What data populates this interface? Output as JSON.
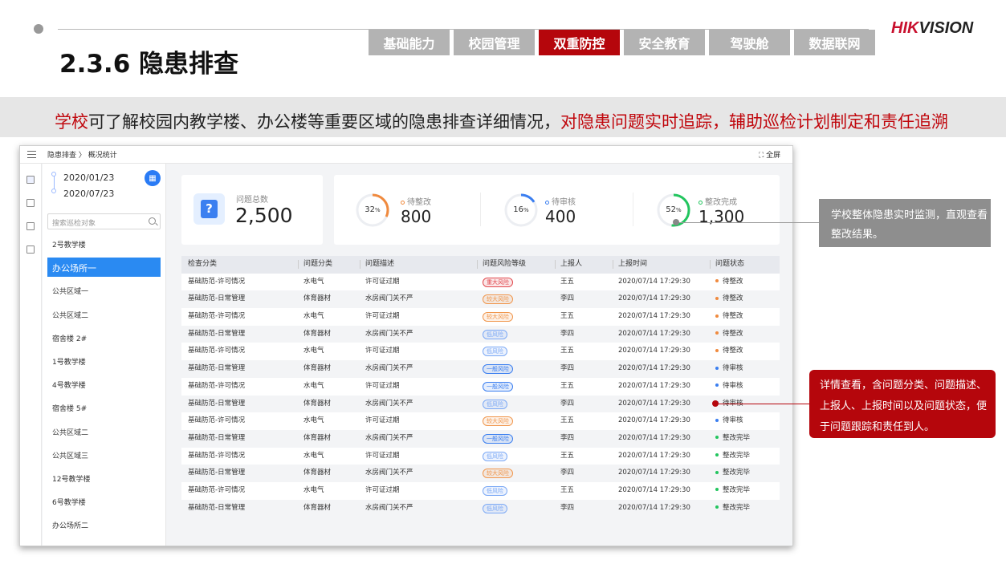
{
  "header": {
    "title": "2.3.6 隐患排查",
    "nav_tabs": [
      {
        "label": "基础能力",
        "active": false
      },
      {
        "label": "校园管理",
        "active": false
      },
      {
        "label": "双重防控",
        "active": true
      },
      {
        "label": "安全教育",
        "active": false
      },
      {
        "label": "驾驶舱",
        "active": false
      },
      {
        "label": "数据联网",
        "active": false
      }
    ],
    "logo_text": "HIKVISION",
    "accent_color": "#b5060c"
  },
  "banner": {
    "part1": "学校",
    "part2": "可了解校园内教学楼、办公楼等重要区域的隐患排查详细情况，",
    "part3": "对隐患问题实时追踪，辅助巡检计划制定和责任追溯"
  },
  "app": {
    "breadcrumb": "隐患排查 〉 概况统计",
    "fullscreen_label": "⛶ 全屏",
    "date_start": "2020/01/23",
    "date_end": "2020/07/23",
    "search_placeholder": "搜索巡检对象",
    "sidebar_items": [
      "2号教学楼",
      "办公场所一",
      "公共区域一",
      "公共区域二",
      "宿舍楼 2#",
      "1号教学楼",
      "4号教学楼",
      "宿舍楼 5#",
      "公共区域二",
      "公共区域三",
      "12号教学楼",
      "6号教学楼",
      "办公场所二"
    ],
    "sidebar_active_index": 1,
    "total": {
      "label": "问题总数",
      "value": "2,500",
      "icon": "question-icon"
    },
    "stats": [
      {
        "label": "待整改",
        "value": "800",
        "percent": 32,
        "color": "#f08a3e"
      },
      {
        "label": "待审核",
        "value": "400",
        "percent": 16,
        "color": "#3a7ef0"
      },
      {
        "label": "整改完成",
        "value": "1,300",
        "percent": 52,
        "color": "#22c55e"
      }
    ],
    "table": {
      "headers": [
        "检查分类",
        "问题分类",
        "问题描述",
        "问题风险等级",
        "上报人",
        "上报时间",
        "问题状态"
      ],
      "rows": [
        [
          "基础防范-许可情况",
          "水电气",
          "许可证过期",
          "重大风险",
          "王五",
          "2020/07/14 17:29:30",
          "待整改"
        ],
        [
          "基础防范-日常管理",
          "体育器材",
          "水房阀门关不严",
          "较大风险",
          "李四",
          "2020/07/14 17:29:30",
          "待整改"
        ],
        [
          "基础防范-许可情况",
          "水电气",
          "许可证过期",
          "较大风险",
          "王五",
          "2020/07/14 17:29:30",
          "待整改"
        ],
        [
          "基础防范-日常管理",
          "体育器材",
          "水房阀门关不严",
          "低风险",
          "李四",
          "2020/07/14 17:29:30",
          "待整改"
        ],
        [
          "基础防范-许可情况",
          "水电气",
          "许可证过期",
          "低风险",
          "王五",
          "2020/07/14 17:29:30",
          "待整改"
        ],
        [
          "基础防范-日常管理",
          "体育器材",
          "水房阀门关不严",
          "一般风险",
          "李四",
          "2020/07/14 17:29:30",
          "待审核"
        ],
        [
          "基础防范-许可情况",
          "水电气",
          "许可证过期",
          "一般风险",
          "王五",
          "2020/07/14 17:29:30",
          "待审核"
        ],
        [
          "基础防范-日常管理",
          "体育器材",
          "水房阀门关不严",
          "低风险",
          "李四",
          "2020/07/14 17:29:30",
          "待审核"
        ],
        [
          "基础防范-许可情况",
          "水电气",
          "许可证过期",
          "较大风险",
          "王五",
          "2020/07/14 17:29:30",
          "待审核"
        ],
        [
          "基础防范-日常管理",
          "体育器材",
          "水房阀门关不严",
          "一般风险",
          "李四",
          "2020/07/14 17:29:30",
          "整改完毕"
        ],
        [
          "基础防范-许可情况",
          "水电气",
          "许可证过期",
          "低风险",
          "王五",
          "2020/07/14 17:29:30",
          "整改完毕"
        ],
        [
          "基础防范-日常管理",
          "体育器材",
          "水房阀门关不严",
          "较大风险",
          "李四",
          "2020/07/14 17:29:30",
          "整改完毕"
        ],
        [
          "基础防范-许可情况",
          "水电气",
          "许可证过期",
          "低风险",
          "王五",
          "2020/07/14 17:29:30",
          "整改完毕"
        ],
        [
          "基础防范-日常管理",
          "体育器材",
          "水房阀门关不严",
          "低风险",
          "李四",
          "2020/07/14 17:29:30",
          "整改完毕"
        ]
      ]
    },
    "risk_colors": {
      "重大风险": "#e0474c",
      "较大风险": "#f0964c",
      "一般风险": "#3a7ef0",
      "低风险": "#7aa8f5"
    },
    "status_colors": {
      "待整改": "#f08a3e",
      "待审核": "#3a7ef0",
      "整改完毕": "#22c55e"
    }
  },
  "callouts": {
    "monitor": "学校整体隐患实时监测，直观查看整改结果。",
    "detail": "详情查看，含问题分类、问题描述、上报人、上报时间以及问题状态，便于问题跟踪和责任到人。"
  }
}
